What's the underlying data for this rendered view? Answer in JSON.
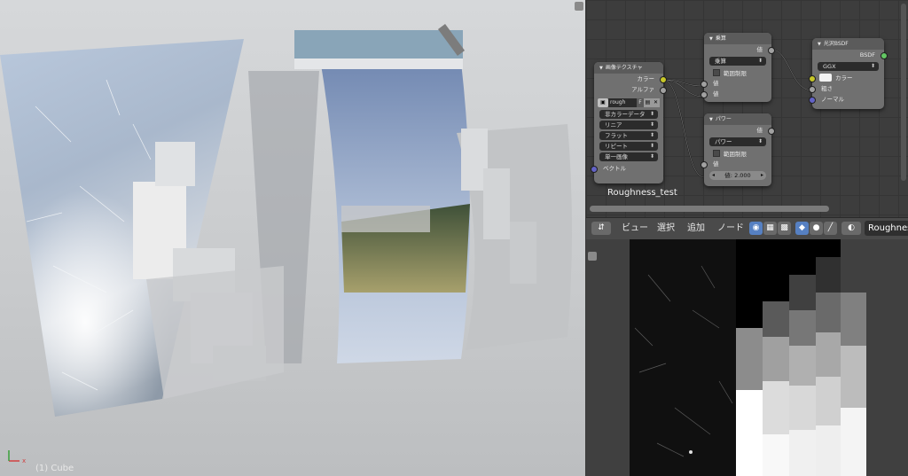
{
  "viewport": {
    "object_label": "(1) Cube"
  },
  "node_editor": {
    "nodes": {
      "image_texture": {
        "title": "画像テクスチャ",
        "outputs": [
          "カラー",
          "アルファ"
        ],
        "image_name": "rough",
        "users_button": "F",
        "options": [
          "非カラーデータ",
          "リニア",
          "フラット",
          "リピート",
          "単一画像"
        ],
        "input": "ベクトル"
      },
      "math_top": {
        "title": "乗算",
        "output": "値",
        "operation": "乗算",
        "clamp_label": "範囲制限",
        "inputs": [
          "値",
          "値"
        ]
      },
      "power": {
        "title": "パワー",
        "output": "値",
        "operation": "パワー",
        "clamp_label": "範囲制限",
        "input": "値",
        "value_label": "値:",
        "value": "2.000"
      },
      "glossy": {
        "title": "光沢BSDF",
        "output": "BSDF",
        "distribution": "GGX",
        "inputs": [
          "カラー",
          "粗さ",
          "ノーマル"
        ]
      }
    },
    "frame_label": "Roughness_test"
  },
  "header": {
    "menus": [
      "ビュー",
      "選択",
      "追加",
      "ノード"
    ],
    "texture_name": "Roughness"
  },
  "colors": {
    "accent": "#5680c2",
    "socket_color": "#c7c729",
    "socket_gray": "#a1a1a1",
    "socket_vector": "#6363c7",
    "socket_shader": "#63c763"
  }
}
